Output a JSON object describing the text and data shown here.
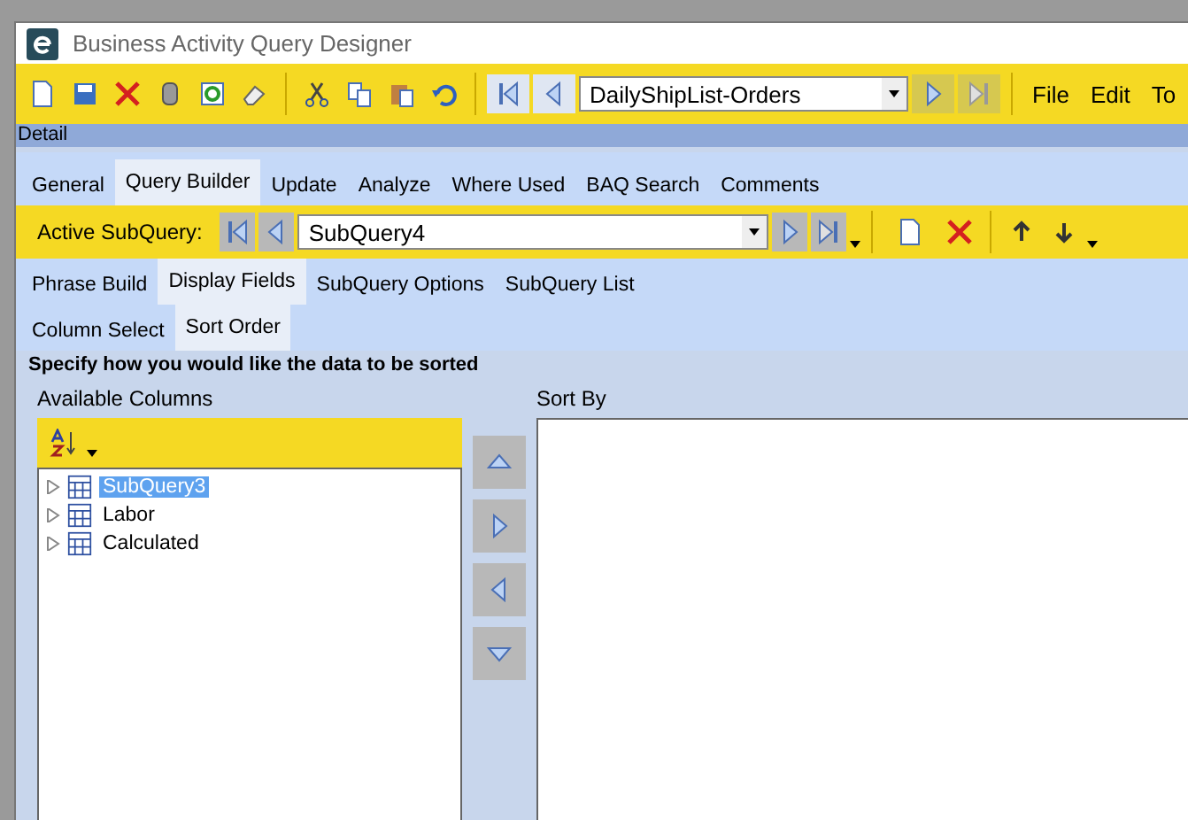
{
  "window": {
    "title": "Business Activity Query Designer"
  },
  "toolbar": {
    "record_selector": "DailyShipList-Orders",
    "menus": [
      "File",
      "Edit",
      "To"
    ]
  },
  "panel_title": "Detail",
  "tabs": [
    {
      "label": "General",
      "selected": false
    },
    {
      "label": "Query Builder",
      "selected": true
    },
    {
      "label": "Update",
      "selected": false
    },
    {
      "label": "Analyze",
      "selected": false
    },
    {
      "label": "Where Used",
      "selected": false
    },
    {
      "label": "BAQ Search",
      "selected": false
    },
    {
      "label": "Comments",
      "selected": false
    }
  ],
  "subquery_bar": {
    "label": "Active SubQuery:",
    "value": "SubQuery4"
  },
  "subtabs": [
    {
      "label": "Phrase Build",
      "selected": false
    },
    {
      "label": "Display Fields",
      "selected": true
    },
    {
      "label": "SubQuery Options",
      "selected": false
    },
    {
      "label": "SubQuery List",
      "selected": false
    }
  ],
  "inner_tabs": [
    {
      "label": "Column Select",
      "selected": false
    },
    {
      "label": "Sort Order",
      "selected": true
    }
  ],
  "instruction": "Specify how you would like the data to be sorted",
  "available_columns": {
    "heading": "Available Columns",
    "items": [
      {
        "label": "SubQuery3",
        "selected": true,
        "expanded": false
      },
      {
        "label": "Labor",
        "selected": false,
        "expanded": false
      },
      {
        "label": "Calculated",
        "selected": false,
        "expanded": false
      }
    ]
  },
  "sort_by": {
    "heading": "Sort By"
  }
}
